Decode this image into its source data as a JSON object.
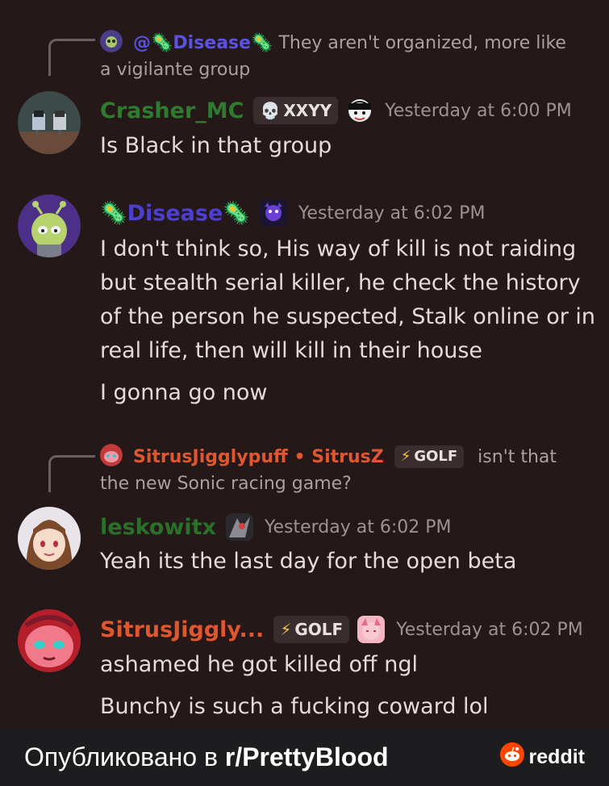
{
  "messages": [
    {
      "reply": {
        "author": "@🦠Disease🦠",
        "text": "They aren't organized, more like a vigilante group"
      },
      "author": "Crasher_MC",
      "author_color": "#2f7a2f",
      "tag": "XXYY",
      "timestamp": "Yesterday at 6:00 PM",
      "lines": [
        "Is Black in that group"
      ]
    },
    {
      "author": "🦠Disease🦠",
      "author_color": "#4b3fd1",
      "timestamp": "Yesterday at 6:02 PM",
      "lines": [
        "I don't think so, His way of kill is not raiding but stealth serial killer, he check the history of the person he suspected, Stalk online or in real life, then will kill in their house",
        "I gonna go now"
      ]
    },
    {
      "reply": {
        "author": "SitrusJigglypuff • SitrusZ",
        "tag": "GOLF",
        "text": "isn't that the new Sonic racing game?"
      },
      "author": "leskowitx",
      "author_color": "#2a6f2a",
      "timestamp": "Yesterday at 6:02 PM",
      "lines": [
        "Yeah its the last day for the open beta"
      ]
    },
    {
      "author": "SitrusJiggly...",
      "author_color": "#e0562f",
      "tag": "GOLF",
      "timestamp": "Yesterday at 6:02 PM",
      "lines": [
        "ashamed he got killed off ngl",
        "Bunchy is such a fucking coward lol"
      ]
    }
  ],
  "footer": {
    "published_prefix": "Опубликовано в ",
    "subreddit": "r/PrettyBlood",
    "brand": "reddit"
  },
  "colors": {
    "background": "#251819",
    "footer": "#1d1d1f",
    "reply_line": "#6a5f62"
  }
}
